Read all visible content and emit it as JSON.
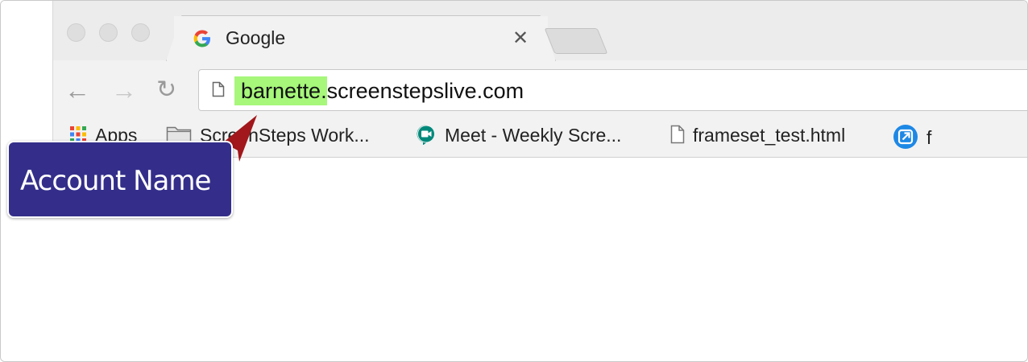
{
  "tab": {
    "title": "Google",
    "close_glyph": "✕",
    "favicon_letter": "G"
  },
  "nav": {
    "back_glyph": "←",
    "forward_glyph": "→",
    "reload_glyph": "↻"
  },
  "address_bar": {
    "url_highlight": "barnette.",
    "url_rest": "screenstepslive.com"
  },
  "bookmarks": [
    {
      "label": "Apps",
      "icon": "apps-grid-icon"
    },
    {
      "label": "ScreenSteps Work...",
      "icon": "folder-icon"
    },
    {
      "label": "Meet - Weekly Scre...",
      "icon": "google-meet-icon"
    },
    {
      "label": "frameset_test.html",
      "icon": "page-icon"
    },
    {
      "label": "f",
      "icon": "link-icon"
    }
  ],
  "callout": {
    "text": "Account Name",
    "color": "#342e8a"
  },
  "colors": {
    "highlight": "#a6f77a",
    "arrow": "#a1171b"
  }
}
